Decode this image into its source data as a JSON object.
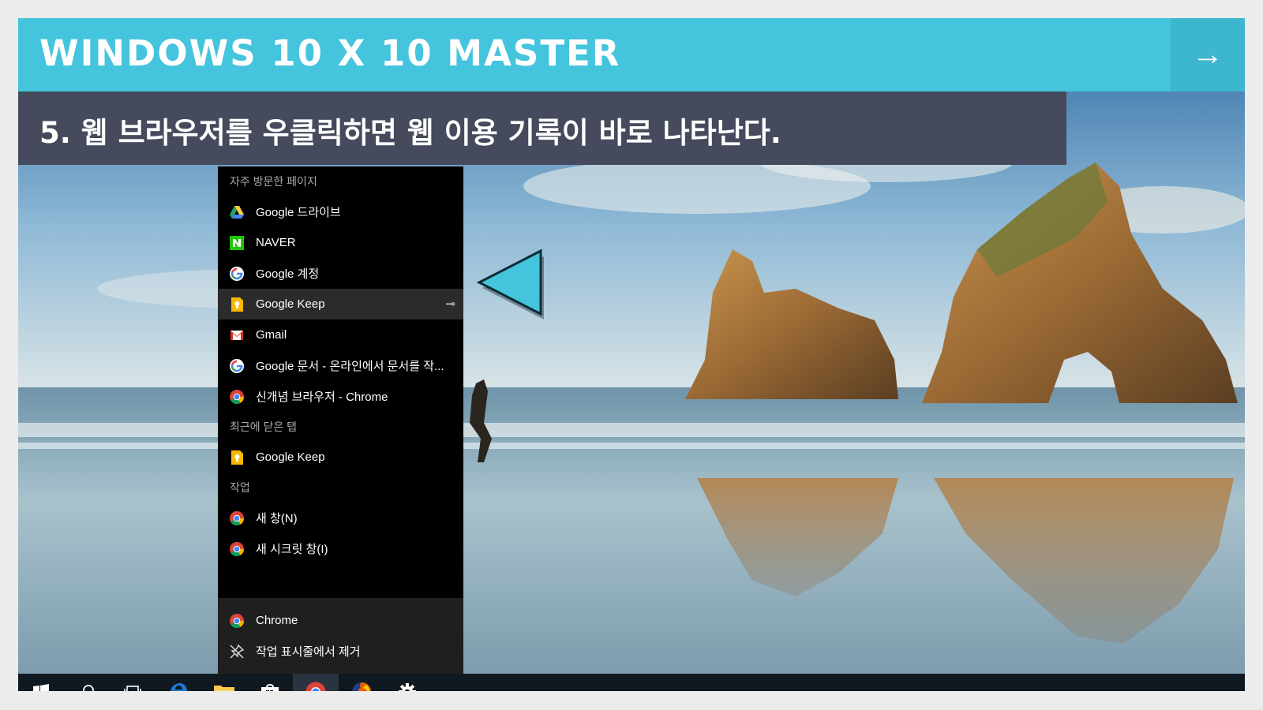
{
  "header": {
    "title": "WINDOWS 10 X 10 MASTER",
    "next_arrow": "→"
  },
  "subtitle": "5. 웹 브라우저를 우클릭하면 웹 이용 기록이 바로 나타난다.",
  "jumplist": {
    "frequent_title": "자주 방문한 페이지",
    "frequent": [
      {
        "label": "Google 드라이브",
        "icon": "google-drive-icon"
      },
      {
        "label": "NAVER",
        "icon": "naver-icon"
      },
      {
        "label": "Google 계정",
        "icon": "google-g-icon"
      },
      {
        "label": "Google Keep",
        "icon": "google-keep-icon",
        "highlighted": true
      },
      {
        "label": "Gmail",
        "icon": "gmail-icon"
      },
      {
        "label": "Google 문서 - 온라인에서 문서를 작...",
        "icon": "google-g-icon"
      },
      {
        "label": "신개념 브라우저 - Chrome",
        "icon": "chrome-icon"
      }
    ],
    "recent_title": "최근에 닫은 탭",
    "recent": [
      {
        "label": "Google Keep",
        "icon": "google-keep-icon"
      }
    ],
    "tasks_title": "작업",
    "tasks": [
      {
        "label": "새 창(N)",
        "icon": "chrome-icon"
      },
      {
        "label": "새 시크릿 창(I)",
        "icon": "chrome-icon"
      }
    ],
    "bottom": [
      {
        "label": "Chrome",
        "icon": "chrome-icon"
      },
      {
        "label": "작업 표시줄에서 제거",
        "icon": "unpin-icon"
      }
    ]
  },
  "taskbar": {
    "icons": [
      "windows-start-icon",
      "search-icon",
      "task-view-icon",
      "edge-icon",
      "file-explorer-icon",
      "store-icon",
      "chrome-icon",
      "firefox-icon",
      "settings-gear-icon"
    ],
    "active": "chrome-icon"
  },
  "colors": {
    "header_bg": "#44c4dd",
    "subtitle_bg": "#454b5c",
    "pointer": "#44c4dd"
  }
}
